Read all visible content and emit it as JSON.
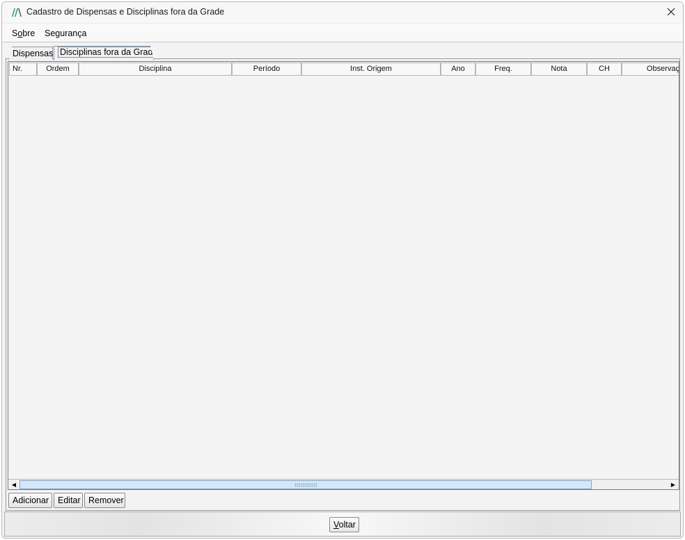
{
  "window": {
    "title": "Cadastro de Dispensas e Disciplinas fora da Grade",
    "icon": "app-logo-icon",
    "close_glyph": "✕"
  },
  "menu": {
    "items": [
      {
        "label_pre": "S",
        "mnemonic": "o",
        "label_post": "bre"
      },
      {
        "label_pre": "Segurança",
        "mnemonic": "",
        "label_post": ""
      }
    ]
  },
  "tabs": [
    {
      "label": "Dispensas",
      "active": false
    },
    {
      "label": "Disciplinas fora da Grade",
      "active": true
    }
  ],
  "table": {
    "columns": [
      "Nr.",
      "Ordem",
      "Disciplina",
      "Período",
      "Inst. Origem",
      "Ano",
      "Freq.",
      "Nota",
      "CH",
      "Observaç"
    ],
    "rows": []
  },
  "scrollbar": {
    "left_arrow": "◀",
    "right_arrow": "▶"
  },
  "actions": {
    "add_label": "Adicionar",
    "edit_label": "Editar",
    "remove_label": "Remover"
  },
  "footer": {
    "back_mnemonic": "V",
    "back_rest": "oltar"
  },
  "colors": {
    "accent": "#1a9a8a",
    "thumb": "#d5e7f6"
  }
}
